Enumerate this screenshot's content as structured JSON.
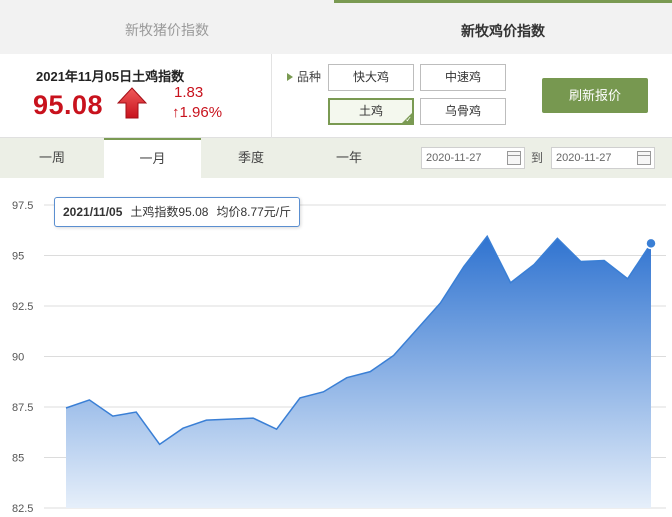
{
  "tabs": {
    "pig_index": "新牧猪价指数",
    "chicken_index": "新牧鸡价指数"
  },
  "summary": {
    "title": "2021年11月05日土鸡指数",
    "value": "95.08",
    "change": "1.83",
    "change_pct": "↑1.96%"
  },
  "variety": {
    "label": "品种",
    "options": [
      "快大鸡",
      "中速鸡",
      "土鸡",
      "乌骨鸡"
    ],
    "selected": "土鸡"
  },
  "refresh_label": "刷新报价",
  "periods": [
    "一周",
    "一月",
    "季度",
    "一年"
  ],
  "active_period": "一月",
  "date_range": {
    "start": "2020-11-27",
    "separator": "到",
    "end": "2020-11-27"
  },
  "tooltip": {
    "date": "2021/11/05",
    "index_text": "土鸡指数95.08",
    "avg_text": "均价8.77元/斤"
  },
  "colors": {
    "accent_green": "#779850",
    "price_red": "#c8121d",
    "line_blue": "#3a7fd5"
  },
  "chart_data": {
    "type": "area",
    "title": "",
    "xlabel": "",
    "ylabel": "",
    "ylim": [
      82.5,
      97.5
    ],
    "yticks": [
      97.5,
      95,
      92.5,
      90,
      87.5,
      85,
      82.5
    ],
    "ytick_labels": [
      "97.5",
      "95",
      "92.5",
      "90",
      "87.5",
      "85",
      "82.5"
    ],
    "grid": true,
    "series": [
      {
        "values": [
          87.45,
          87.85,
          87.05,
          87.25,
          85.65,
          86.45,
          86.85,
          86.9,
          86.95,
          86.4,
          87.95,
          88.25,
          88.95,
          89.25,
          90.05,
          91.35,
          92.65,
          94.45,
          95.95,
          93.65,
          94.55,
          95.85,
          94.7,
          94.75,
          93.85,
          95.6
        ]
      }
    ],
    "highlight_index": 25
  }
}
